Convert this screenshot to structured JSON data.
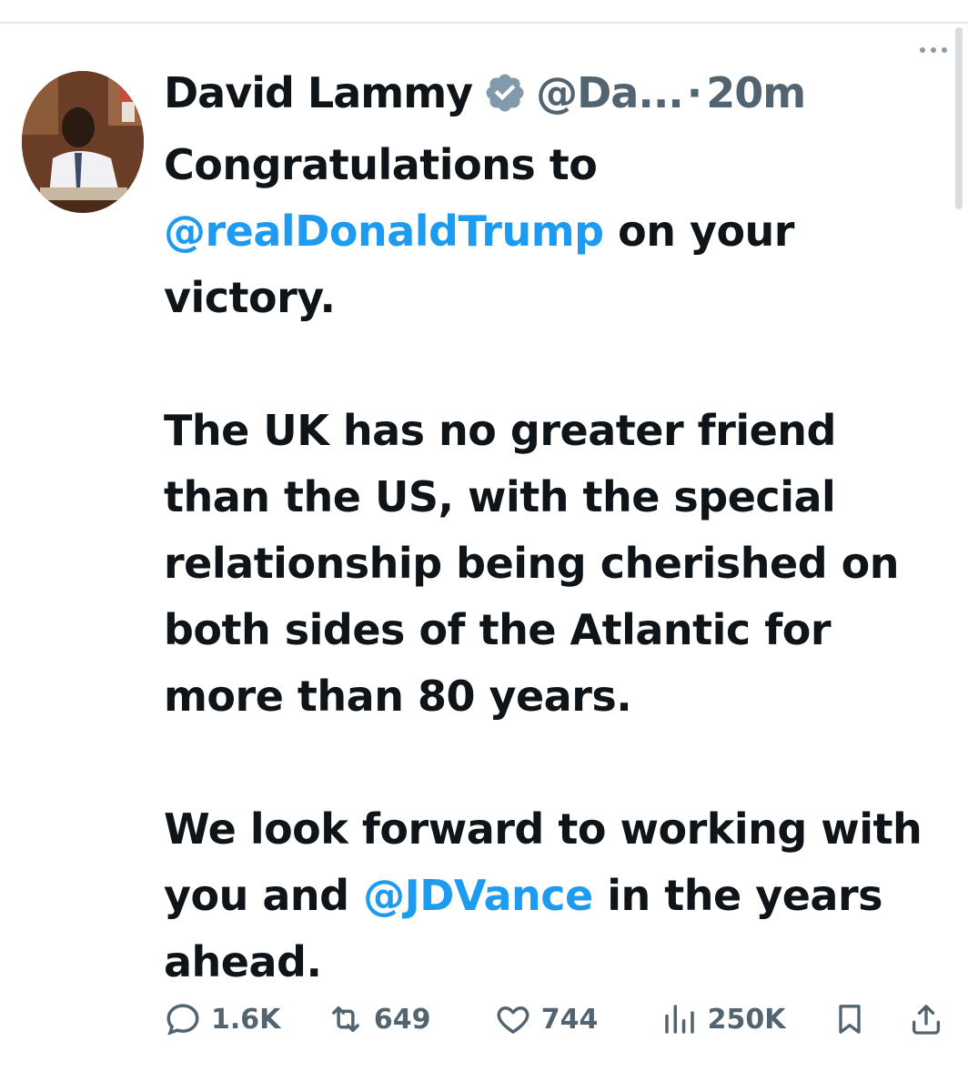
{
  "tweet": {
    "author_name": "David Lammy",
    "handle": "@Da...",
    "separator": "·",
    "time": "20m",
    "paragraphs": [
      {
        "seg1": "Congratulations to ",
        "mention1": "@realDonaldTrump",
        "seg2": " on your victory."
      },
      {
        "text": "The UK has no greater friend than the US, with the special relationship being cherished on both sides of the Atlantic for more than 80 years."
      },
      {
        "seg1": "We look forward to working with you and ",
        "mention1": "@JDVance",
        "seg2": " in the years ahead."
      }
    ],
    "stats": {
      "replies": "1.6K",
      "reposts": "649",
      "likes": "744",
      "views": "250K"
    }
  },
  "icons": {
    "verified": "verified-badge-icon",
    "more": "more-icon",
    "reply": "reply-icon",
    "repost": "repost-icon",
    "like": "like-icon",
    "views": "views-icon",
    "bookmark": "bookmark-icon",
    "share": "share-icon"
  },
  "colors": {
    "text": "#0f1419",
    "secondary": "#536471",
    "mention": "#1d9bf0",
    "badge": "#829aab"
  }
}
